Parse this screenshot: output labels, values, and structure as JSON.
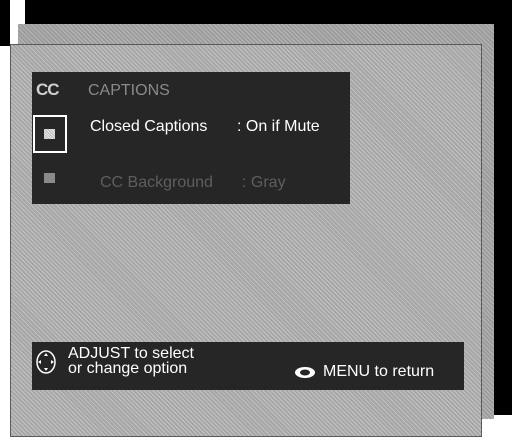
{
  "menu": {
    "cc_icon": "CC",
    "title": "CAPTIONS",
    "rows": [
      {
        "label": "Closed Captions",
        "value": ": On if Mute",
        "state": "selected"
      },
      {
        "label": "CC Background",
        "value": ": Gray",
        "state": "disabled"
      }
    ]
  },
  "hint": {
    "line1": "ADJUST  to select",
    "line2": "or change option",
    "menu_return": "MENU to return"
  },
  "colors": {
    "panel": "#262626",
    "screen_hatch": "#a6a6a6",
    "frame": "#000000",
    "selected_text": "#ffffff",
    "disabled_text": "#5e5e5e"
  },
  "icons": [
    "cc-icon",
    "adjust-joystick-icon",
    "menu-button-icon",
    "row-bullet-icon"
  ]
}
